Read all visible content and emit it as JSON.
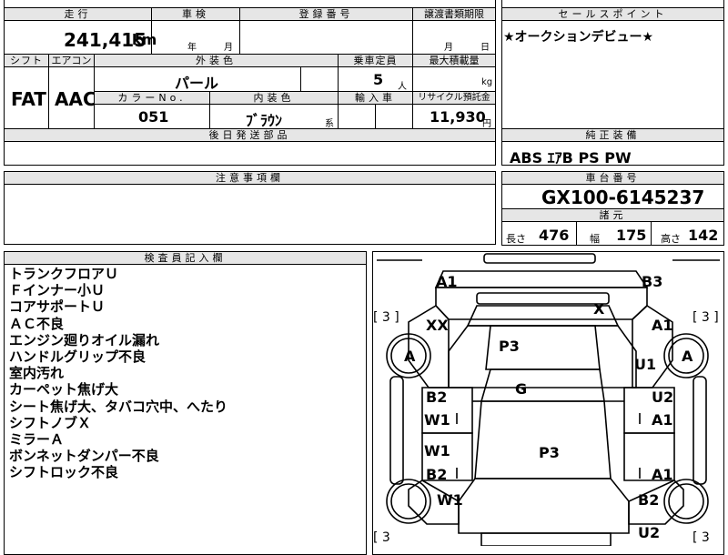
{
  "top_left": {
    "mileage_header": "走行",
    "mileage_value": "241,415",
    "mileage_unit": "km",
    "shaken_header": "車検",
    "shaken_year_unit": "年",
    "shaken_month_unit": "月",
    "registration_header": "登録番号",
    "transfer_header": "譲渡書類期限",
    "transfer_month_unit": "月",
    "transfer_day_unit": "日",
    "shift_header": "シフト",
    "aircon_header": "エアコン",
    "shift_value": "FAT",
    "aircon_value": "AAC",
    "exterior_header": "外装色",
    "exterior_value": "パール",
    "capacity_header": "乗車定員",
    "capacity_value": "5",
    "capacity_unit": "人",
    "load_header": "最大積載量",
    "load_unit": "kg",
    "color_no_header": "カラーNo.",
    "color_no_value": "051",
    "interior_header": "内装色",
    "interior_value": "ﾌﾞﾗｳﾝ",
    "interior_suffix": "系",
    "import_header": "輸入車",
    "recycle_header": "リサイクル預託金",
    "recycle_value": "11,930",
    "recycle_unit": "円",
    "later_parts_header": "後日発送部品",
    "caution_header": "注意事項欄",
    "inspector_header": "検査員記入欄"
  },
  "right": {
    "sales_header": "セールスポイント",
    "sales_text": "★オークションデビュー★",
    "equipment_header": "純正装備",
    "equipment_value": "ABS ｴｱB PS PW",
    "chassis_header": "車台番号",
    "chassis_value": "GX100-6145237",
    "specs_header": "諸元",
    "length_label": "長さ",
    "length_value": "476",
    "width_label": "幅",
    "width_value": "175",
    "height_label": "高さ",
    "height_value": "142"
  },
  "inspector_notes": [
    "トランクフロアＵ",
    "Ｆインナー小Ｕ",
    "コアサポートＵ",
    "ＡＣ不良",
    "エンジン廻りオイル漏れ",
    "ハンドルグリップ不良",
    "室内汚れ",
    "カーペット焦げ大",
    "シート焦げ大、タバコ穴中、へたり",
    "シフトノブＸ",
    "ミラーＡ",
    "ボンネットダンパー不良",
    "シフトロック不良"
  ],
  "diagram": {
    "tire_left_top": "[ 3 ]",
    "tire_right_top": "[ 3 ]",
    "tire_left_bottom": "[ 3",
    "tire_right_bottom": "[ 3",
    "front_left": "A1",
    "front_right": "B3",
    "windshield": "X",
    "hood_left": "XX",
    "fender_right": "A1",
    "wheel_left_front": "A",
    "wheel_right_front": "A",
    "roof": "P3",
    "door_right_upper": "U1",
    "center": "G",
    "front_door_left_a": "B2",
    "front_door_left_b": "W1",
    "front_door_right_a": "U2",
    "front_door_right_b": "A1",
    "rear_door_left_a": "W1",
    "rear_door_left_b": "B2",
    "rear_roof": "P3",
    "rear_door_right": "A1",
    "rear_fender_left": "W1",
    "rear_fender_right": "B2",
    "rear_bumper_right": "U2"
  }
}
